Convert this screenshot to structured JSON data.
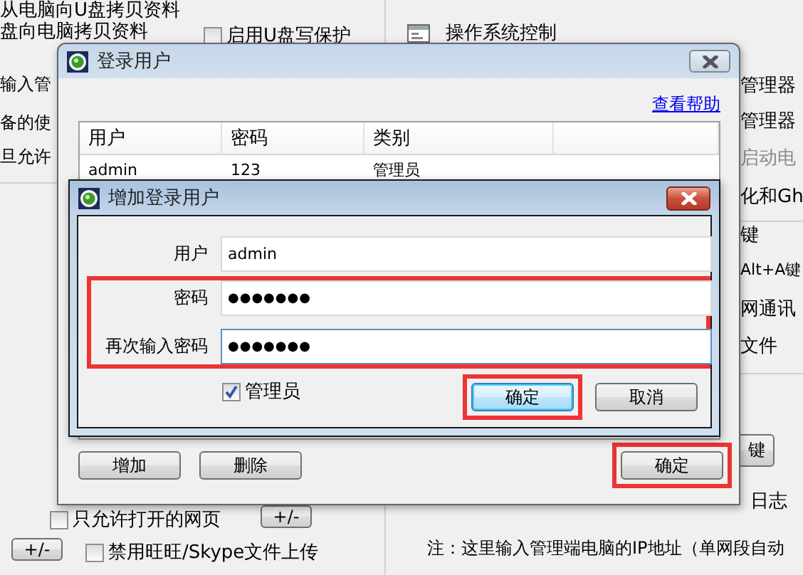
{
  "background": {
    "left_texts": [
      "从电脑向U盘拷贝资料",
      "盘向电脑拷贝资料",
      "输入管",
      "备的使",
      "旦允许"
    ],
    "write_protect": {
      "label": "启用U盘写保护",
      "checked": false
    },
    "section_title": "操作系统控制",
    "right_texts": [
      {
        "text": "管理器",
        "disabled": false
      },
      {
        "text": "管理器",
        "disabled": false
      },
      {
        "text": "启动电",
        "disabled": true
      },
      {
        "text": "化和Gh",
        "disabled": false
      },
      {
        "text": "键",
        "disabled": false
      },
      {
        "text": "Alt+A键",
        "disabled": false
      },
      {
        "text": "网通讯",
        "disabled": false
      },
      {
        "text": "文件",
        "disabled": false
      }
    ],
    "right_button": "键",
    "log_text": "日志",
    "allowed_pages": {
      "label": "只允许打开的网页",
      "checked": false
    },
    "plus_minus_buttons": [
      "+/-",
      "+/-"
    ],
    "block_upload": {
      "label": "禁用旺旺/Skype文件上传",
      "checked": false
    },
    "note": "注：这里输入管理端电脑的IP地址（单网段自动"
  },
  "login_dialog": {
    "title": "登录用户",
    "help_link": "查看帮助",
    "table": {
      "columns": [
        "用户",
        "密码",
        "类别"
      ],
      "rows": [
        [
          "admin",
          "123",
          "管理员"
        ]
      ]
    },
    "buttons": [
      "增加",
      "删除"
    ],
    "ok_button": {
      "label": "确定",
      "highlighted": true
    }
  },
  "add_user_dialog": {
    "title": "增加登录用户",
    "fields": [
      {
        "label": "用户",
        "value": "admin",
        "focused": false,
        "highlighted": false
      },
      {
        "label": "密码",
        "value": "●●●●●●●",
        "focused": false,
        "highlighted": true
      },
      {
        "label": "再次输入密码",
        "value": "●●●●●●●",
        "focused": true,
        "highlighted": true
      }
    ],
    "admin_checkbox": {
      "label": "管理员",
      "checked": true
    },
    "buttons": [
      {
        "label": "确定",
        "default": true,
        "highlighted": true
      },
      {
        "label": "取消",
        "default": false,
        "highlighted": false
      }
    ]
  }
}
